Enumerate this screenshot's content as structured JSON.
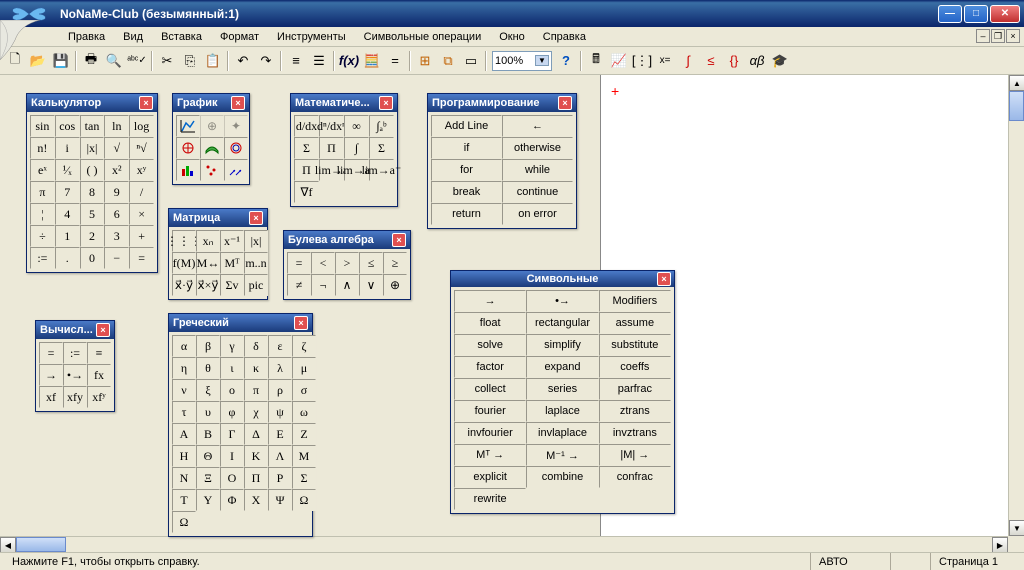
{
  "title": "NoNaMe-Club (безымянный:1)",
  "menu": [
    "Правка",
    "Вид",
    "Вставка",
    "Формат",
    "Инструменты",
    "Символьные операции",
    "Окно",
    "Справка"
  ],
  "toolbar": {
    "zoom": "100%"
  },
  "status": {
    "hint": "Нажмите F1, чтобы открыть справку.",
    "mode": "АВТО",
    "page": "Страница 1"
  },
  "palettes": {
    "calculator": {
      "title": "Калькулятор",
      "grid": [
        [
          "sin",
          "cos",
          "tan",
          "ln",
          "log"
        ],
        [
          "n!",
          "i",
          "|x|",
          "√",
          "ⁿ√"
        ],
        [
          "eˣ",
          "¹⁄ₓ",
          "( )",
          "x²",
          "xʸ"
        ],
        [
          "π",
          "7",
          "8",
          "9",
          "/"
        ],
        [
          "¦",
          "4",
          "5",
          "6",
          "×"
        ],
        [
          "÷",
          "1",
          "2",
          "3",
          "+"
        ],
        [
          ":=",
          ".",
          "0",
          "−",
          "="
        ]
      ]
    },
    "graph": {
      "title": "График",
      "icons": [
        [
          "xy-plot",
          "zoom",
          "trace"
        ],
        [
          "polar",
          "surface",
          "contour"
        ],
        [
          "bar3d",
          "scatter3d",
          "vector"
        ]
      ]
    },
    "math": {
      "title": "Математиче...",
      "grid": [
        [
          "d/dx",
          "dⁿ/dxⁿ",
          "∞",
          "∫ₐᵇ"
        ],
        [
          "Σ",
          "Π",
          "∫",
          "Σ"
        ],
        [
          "Π",
          "lim→a",
          "lim→a⁺",
          "lim→a⁻"
        ],
        [
          "∇f",
          "",
          "",
          ""
        ]
      ]
    },
    "programming": {
      "title": "Программирование",
      "grid": [
        [
          "Add Line",
          "←"
        ],
        [
          "if",
          "otherwise"
        ],
        [
          "for",
          "while"
        ],
        [
          "break",
          "continue"
        ],
        [
          "return",
          "on error"
        ]
      ]
    },
    "matrix": {
      "title": "Матрица",
      "grid": [
        [
          "⋮⋮⋮",
          "xₙ",
          "x⁻¹",
          "|x|"
        ],
        [
          "f(M)",
          "M↔",
          "Mᵀ",
          "m..n"
        ],
        [
          "x⃗·y⃗",
          "x⃗×y⃗",
          "Σv",
          "pic"
        ]
      ]
    },
    "boolean": {
      "title": "Булева алгебра",
      "grid": [
        [
          "=",
          "<",
          ">",
          "≤",
          "≥"
        ],
        [
          "≠",
          "¬",
          "∧",
          "∨",
          "⊕"
        ]
      ]
    },
    "evaluation": {
      "title": "Вычисл...",
      "grid": [
        [
          "=",
          ":=",
          "≡"
        ],
        [
          "→",
          "•→",
          "fx"
        ],
        [
          "xf",
          "xfy",
          "xfʸ"
        ]
      ]
    },
    "greek": {
      "title": "Греческий",
      "grid": [
        [
          "α",
          "β",
          "γ",
          "δ",
          "ε",
          "ζ"
        ],
        [
          "η",
          "θ",
          "ι",
          "κ",
          "λ",
          "μ"
        ],
        [
          "ν",
          "ξ",
          "ο",
          "π",
          "ρ",
          "σ"
        ],
        [
          "τ",
          "υ",
          "φ",
          "χ",
          "ψ",
          "ω"
        ],
        [
          "Α",
          "Β",
          "Γ",
          "Δ",
          "Ε",
          "Ζ"
        ],
        [
          "Η",
          "Θ",
          "Ι",
          "Κ",
          "Λ",
          "Μ"
        ],
        [
          "Ν",
          "Ξ",
          "Ο",
          "Π",
          "Ρ",
          "Σ"
        ],
        [
          "Τ",
          "Υ",
          "Φ",
          "Χ",
          "Ψ",
          "Ω"
        ]
      ],
      "extra": "Ω"
    },
    "symbolic": {
      "title": "Символьные",
      "grid": [
        [
          "→",
          "•→",
          "Modifiers"
        ],
        [
          "float",
          "rectangular",
          "assume"
        ],
        [
          "solve",
          "simplify",
          "substitute"
        ],
        [
          "factor",
          "expand",
          "coeffs"
        ],
        [
          "collect",
          "series",
          "parfrac"
        ],
        [
          "fourier",
          "laplace",
          "ztrans"
        ],
        [
          "invfourier",
          "invlaplace",
          "invztrans"
        ],
        [
          "Mᵀ →",
          "M⁻¹ →",
          "|M| →"
        ],
        [
          "explicit",
          "combine",
          "confrac"
        ],
        [
          "rewrite",
          "",
          ""
        ]
      ]
    }
  }
}
